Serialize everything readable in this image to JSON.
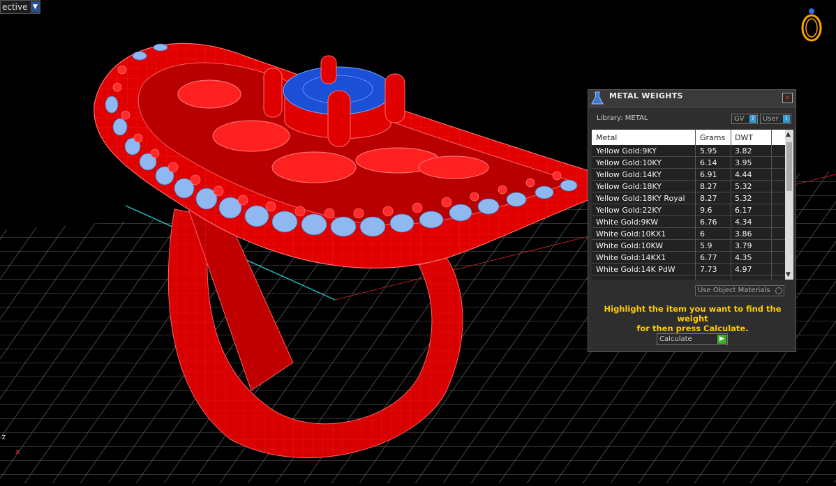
{
  "viewport": {
    "view_label": "ective",
    "axis_z": "z",
    "axis_x": "x"
  },
  "panel": {
    "title": "METAL WEIGHTS",
    "library_label": "Library: METAL",
    "gv_label": "GV",
    "user_label": "User",
    "table": {
      "columns": [
        "Metal",
        "Grams",
        "DWT"
      ],
      "rows": [
        [
          "Yellow Gold:9KY",
          "5.95",
          "3.82"
        ],
        [
          "Yellow Gold:10KY",
          "6.14",
          "3.95"
        ],
        [
          "Yellow Gold:14KY",
          "6.91",
          "4.44"
        ],
        [
          "Yellow Gold:18KY",
          "8.27",
          "5.32"
        ],
        [
          "Yellow Gold:18KY Royal",
          "8.27",
          "5.32"
        ],
        [
          "Yellow Gold:22KY",
          "9.6",
          "6.17"
        ],
        [
          "White Gold:9KW",
          "6.76",
          "4.34"
        ],
        [
          "White Gold:10KX1",
          "6",
          "3.86"
        ],
        [
          "White Gold:10KW",
          "5.9",
          "3.79"
        ],
        [
          "White Gold:14KX1",
          "6.77",
          "4.35"
        ],
        [
          "White Gold:14K PdW",
          "7.73",
          "4.97"
        ]
      ]
    },
    "use_object_materials": "Use Object Materials",
    "instruction_line1": "Highlight the item you want to find the weight",
    "instruction_line2": "for then press Calculate.",
    "calculate_label": "Calculate"
  },
  "colors": {
    "ring_metal": "#e00000",
    "gem": "#1a4fd6",
    "accent_stones": "#8fb8f0",
    "instruction_text": "#ffcc00",
    "grid": "#6a6a6a"
  }
}
